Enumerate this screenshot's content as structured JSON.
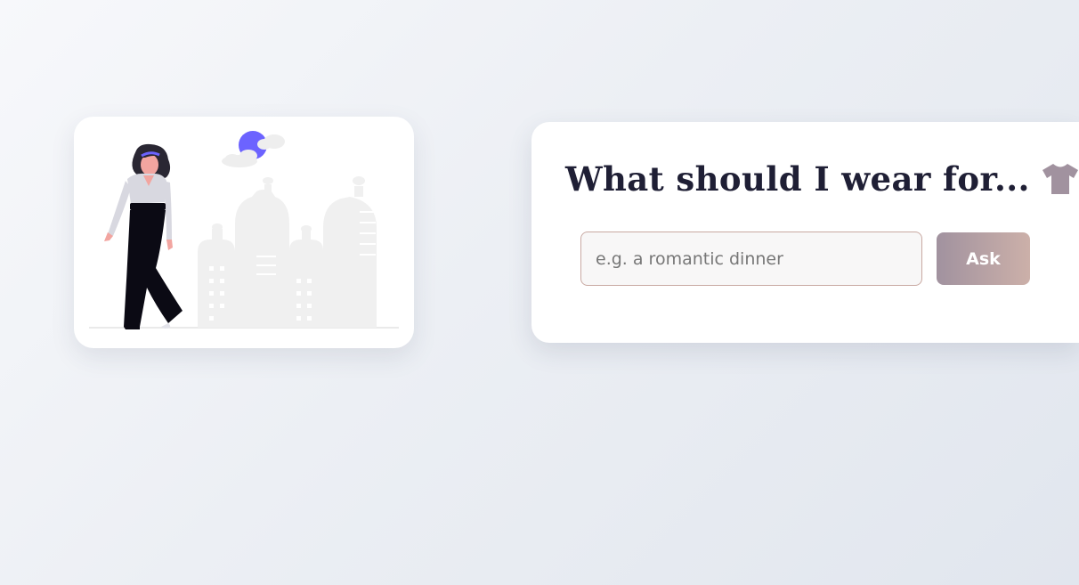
{
  "illustration": {
    "icon": "woman-walking-city-illustration",
    "colors": {
      "accent": "#6c63ff",
      "skin": "#f2a5a0",
      "pants": "#0b0a14",
      "blouse": "#d8d8e0",
      "city": "#f0f0f0"
    }
  },
  "prompt": {
    "title": "What should I wear for...",
    "title_icon": "t-shirt-icon",
    "input_placeholder": "e.g. a romantic dinner",
    "input_value": "",
    "ask_label": "Ask"
  },
  "colors": {
    "title": "#1f1f35",
    "shirt": "#a1929f",
    "input_border": "#c9a9a2",
    "button_start": "#a1929f",
    "button_end": "#ccb0a9"
  }
}
